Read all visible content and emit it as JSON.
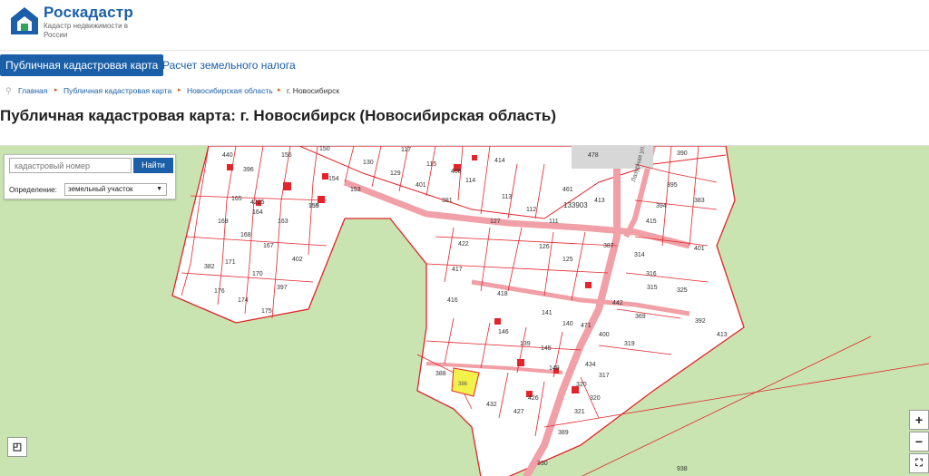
{
  "brand": {
    "title": "Роскадастр",
    "subtitle": "Кадастр недвижимости в России"
  },
  "nav": {
    "tabs": [
      {
        "label": "Публичная кадастровая карта",
        "active": true
      },
      {
        "label": "Расчет земельного налога",
        "active": false
      }
    ]
  },
  "breadcrumbs": [
    "Главная",
    "Публичная кадастровая карта",
    "Новосибирская область",
    "г. Новосибирск"
  ],
  "page_title": "Публичная кадастровая карта: г. Новосибирск (Новосибирская область)",
  "search": {
    "placeholder": "кадастровый номер",
    "button_label": "Найти",
    "definition_label": "Определение:",
    "definition_value": "земельный участок"
  },
  "map": {
    "street_label": "Лазурная ул.",
    "block_label": "133903",
    "highlighted_parcel": "386",
    "parcel_labels": [
      "440",
      "396",
      "156",
      "150",
      "130",
      "129",
      "117",
      "115",
      "408",
      "114",
      "414",
      "478",
      "390",
      "461",
      "165",
      "4225",
      "164",
      "155",
      "154",
      "153",
      "401",
      "381",
      "113",
      "451",
      "413",
      "395",
      "394",
      "383",
      "169",
      "163",
      "159",
      "127",
      "112",
      "111",
      "387",
      "415",
      "168",
      "167",
      "402",
      "422",
      "126",
      "125",
      "414",
      "314",
      "401",
      "382",
      "171",
      "170",
      "397",
      "417",
      "418",
      "422",
      "316",
      "315",
      "325",
      "176",
      "174",
      "175",
      "416",
      "141",
      "140",
      "471",
      "442",
      "369",
      "392",
      "413",
      "146",
      "139",
      "145",
      "400",
      "319",
      "388",
      "149",
      "434",
      "317",
      "386",
      "432",
      "426",
      "427",
      "320",
      "321",
      "389",
      "330",
      "938"
    ],
    "zoom_in": "+",
    "zoom_out": "−"
  },
  "colors": {
    "brand_blue": "#1a5fa8",
    "parcel_border": "#e3242b",
    "map_green": "#c9e4b0",
    "highlight": "#f2f24a"
  }
}
